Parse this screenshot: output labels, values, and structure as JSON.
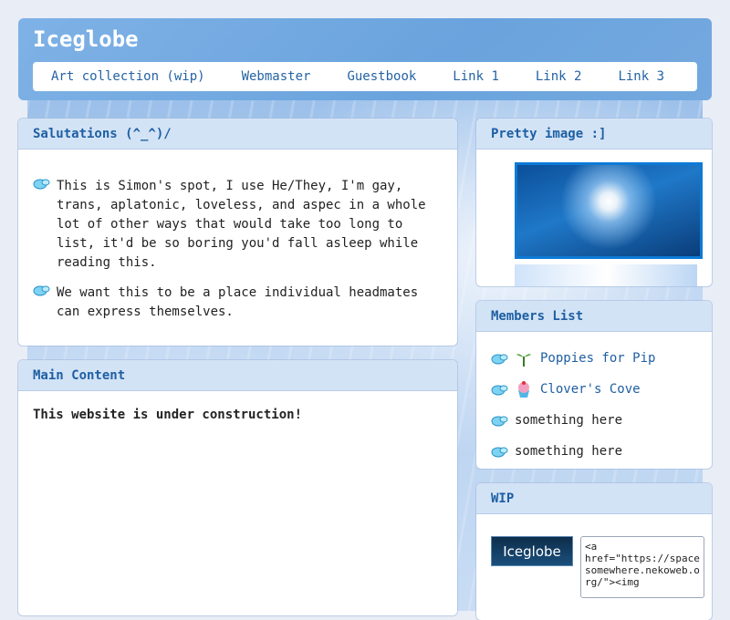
{
  "header": {
    "title": "Iceglobe",
    "nav": [
      "Art collection (wip)",
      "Webmaster",
      "Guestbook",
      "Link 1",
      "Link 2",
      "Link 3"
    ]
  },
  "salutations": {
    "title": "Salutations (^_^)/",
    "paragraphs": [
      "This is Simon's spot, I use He/They, I'm gay, trans, aplatonic, loveless, and aspec in a whole lot of other ways that would take too long to list, it'd be so boring you'd fall asleep while reading this.",
      "We want this to be a place individual headmates can express themselves."
    ]
  },
  "main_content": {
    "title": "Main Content",
    "text": "This website is under construction!"
  },
  "pretty_image": {
    "title": "Pretty image :]"
  },
  "members": {
    "title": "Members List",
    "items": [
      {
        "label": "Poppies for Pip",
        "icon": "sprout-icon",
        "link": true
      },
      {
        "label": "Clover's Cove",
        "icon": "cupcake-icon",
        "link": true
      },
      {
        "label": "something here",
        "icon": "",
        "link": false
      },
      {
        "label": "something here",
        "icon": "",
        "link": false
      }
    ]
  },
  "wip": {
    "title": "WIP",
    "button_text": "Iceglobe",
    "code": "<a href=\"https://spacesomewhere.nekoweb.org/\"><img"
  },
  "colors": {
    "accent": "#1e5fa3",
    "header_bg": "#6aa3dd",
    "panel_head": "#d3e3f6"
  }
}
